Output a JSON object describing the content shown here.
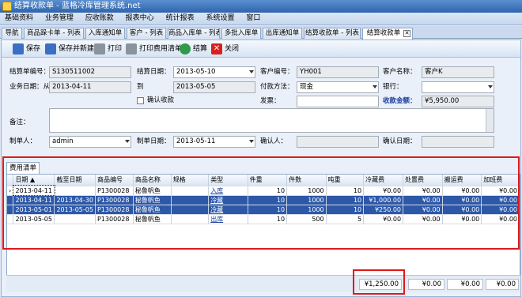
{
  "window": {
    "title": "结算收款单 - 蓝格冷库管理系统.net"
  },
  "menu": [
    "基础资料",
    "业务管理",
    "应收账款",
    "报表中心",
    "统计报表",
    "系统设置",
    "窗口"
  ],
  "tabs": [
    {
      "label": "导航"
    },
    {
      "label": "商品跺卡单 - 列表"
    },
    {
      "label": "入库通知单"
    },
    {
      "label": "客户 - 列表"
    },
    {
      "label": "商品入库单 - 列表"
    },
    {
      "label": "多批入库单"
    },
    {
      "label": "出库通知单"
    },
    {
      "label": "结算收款单 - 列表"
    },
    {
      "label": "结算收款单"
    }
  ],
  "toolbar": {
    "save": "保存",
    "save_new": "保存并新建",
    "print": "打印",
    "print_fee": "打印费用清单",
    "settle": "结算",
    "close": "关闭"
  },
  "form": {
    "settle_no_label": "结算单编号：",
    "settle_no": "S130511002",
    "settle_date_label": "结算日期：",
    "settle_date": "2013-05-10",
    "customer_code_label": "客户编号：",
    "customer_code": "YH001",
    "customer_name_label": "客户名称：",
    "customer_name": "客户K",
    "biz_date_label": "业务日期：从",
    "biz_date_from": "2013-04-11",
    "to_label": "到",
    "biz_date_to": "2013-05-05",
    "pay_method_label": "付款方法：",
    "pay_method": "现金",
    "bank_label": "银行：",
    "bank": "",
    "confirm_receipt_label": "确认收款",
    "invoice_label": "发票：",
    "invoice": "",
    "received_label": "收款金额：",
    "received": "¥5,950.00",
    "remark_label": "备注：",
    "remark": "",
    "maker_label": "制单人：",
    "maker": "admin",
    "make_date_label": "制单日期：",
    "make_date": "2013-05-11",
    "confirmer_label": "确认人：",
    "confirmer": "",
    "confirm_date_label": "确认日期：",
    "confirm_date": ""
  },
  "section_tab": "费用清单",
  "grid": {
    "columns": [
      "日期",
      "截至日期",
      "商品编号",
      "商品名称",
      "规格",
      "类型",
      "件重",
      "件数",
      "吨重",
      "冷藏费",
      "处置费",
      "搬运费",
      "加班费"
    ],
    "rows": [
      {
        "date": "2013-04-11",
        "end": "",
        "code": "P1300028",
        "name": "秘鲁帆鱼",
        "spec": "",
        "type": "入库",
        "w": "10",
        "qty": "1000",
        "ton": "10",
        "cold": "¥0.00",
        "disp": "¥0.00",
        "move": "¥0.00",
        "ot": "¥0.00"
      },
      {
        "date": "2013-04-11",
        "end": "2013-04-30",
        "code": "P1300028",
        "name": "秘鲁帆鱼",
        "spec": "",
        "type": "冷藏",
        "w": "10",
        "qty": "1000",
        "ton": "10",
        "cold": "¥1,000.00",
        "disp": "¥0.00",
        "move": "¥0.00",
        "ot": "¥0.00"
      },
      {
        "date": "2013-05-01",
        "end": "2013-05-05",
        "code": "P1300028",
        "name": "秘鲁帆鱼",
        "spec": "",
        "type": "冷藏",
        "w": "10",
        "qty": "1000",
        "ton": "10",
        "cold": "¥250.00",
        "disp": "¥0.00",
        "move": "¥0.00",
        "ot": "¥0.00"
      },
      {
        "date": "2013-05-05",
        "end": "",
        "code": "P1300028",
        "name": "秘鲁帆鱼",
        "spec": "",
        "type": "出库",
        "w": "10",
        "qty": "500",
        "ton": "5",
        "cold": "¥0.00",
        "disp": "¥0.00",
        "move": "¥0.00",
        "ot": "¥0.00"
      }
    ]
  },
  "footer": {
    "sum_cold": "¥1,250.00",
    "sum_disp": "¥0.00",
    "sum_move": "¥0.00",
    "sum_ot": "¥0.00"
  },
  "colors": {
    "highlight": "#e01818",
    "selected_row": "#2d58a8",
    "received_amount": "#1a3d9c"
  }
}
